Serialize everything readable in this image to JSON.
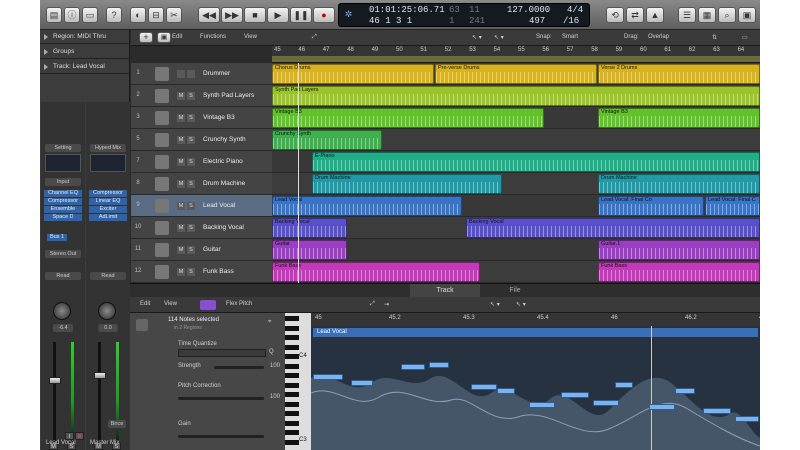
{
  "control_bar": {
    "lcd": {
      "time": "01:01:25:06.71",
      "bars": "46 1 3 1",
      "sub1": "63",
      "sub2": "1",
      "tempo": "127.0000",
      "tempo_sub": "497",
      "sig_top": "4/4",
      "sig_bottom": "/16",
      "sub3": "11",
      "sub4": "241"
    }
  },
  "inspector": {
    "rows": [
      "Region: MIDI Thru",
      "Groups",
      "Track: Lead Vocal"
    ],
    "strip_left": {
      "setting": "Setting",
      "input": "Input",
      "plugins": [
        "Channel EQ",
        "Compressor",
        "Ensemble",
        "Space D"
      ],
      "bus": "Bus 1",
      "output": "Stereo Out",
      "mode": "Read",
      "value": "-6.4",
      "name": "Lead Vocal",
      "m": "M",
      "s": "S",
      "i": "I",
      "r": "R"
    },
    "strip_right": {
      "setting": "Hyped Mix",
      "plugins": [
        "Compressor",
        "Linear EQ",
        "Exciter",
        "AdLimit"
      ],
      "mode": "Read",
      "value": "0.0",
      "bnce": "Bnce",
      "name": "Master Mix",
      "m": "M",
      "s": "S"
    }
  },
  "track_toolbar": {
    "edit": "Edit",
    "functions": "Functions",
    "view": "View",
    "snap_label": "Snap:",
    "snap_value": "Smart",
    "drag_label": "Drag:",
    "drag_value": "Overlap"
  },
  "ruler_marks": [
    "45",
    "46",
    "47",
    "48",
    "49",
    "50",
    "51",
    "52",
    "53",
    "54",
    "55",
    "56",
    "57",
    "58",
    "59",
    "60",
    "61",
    "62",
    "63",
    "64"
  ],
  "tracks": [
    {
      "num": "1",
      "name": "Drummer",
      "m": "",
      "s": ""
    },
    {
      "num": "2",
      "name": "Synth Pad Layers",
      "m": "M",
      "s": "S"
    },
    {
      "num": "3",
      "name": "Vintage B3",
      "m": "M",
      "s": "S"
    },
    {
      "num": "5",
      "name": "Crunchy Synth",
      "m": "M",
      "s": "S"
    },
    {
      "num": "7",
      "name": "Electric Piano",
      "m": "M",
      "s": "S"
    },
    {
      "num": "8",
      "name": "Drum Machine",
      "m": "M",
      "s": "S"
    },
    {
      "num": "9",
      "name": "Lead Vocal",
      "m": "M",
      "s": "S"
    },
    {
      "num": "10",
      "name": "Backing Vocal",
      "m": "M",
      "s": "S"
    },
    {
      "num": "11",
      "name": "Guitar",
      "m": "M",
      "s": "S"
    },
    {
      "num": "12",
      "name": "Funk Bass",
      "m": "M",
      "s": "S"
    }
  ],
  "regions": [
    {
      "lane": 0,
      "label": "Chorus Drums",
      "color": "#d8b21f",
      "start": 0,
      "end": 162
    },
    {
      "lane": 0,
      "label": "Pre-verse Drums",
      "color": "#d8b21f",
      "start": 163,
      "end": 325
    },
    {
      "lane": 0,
      "label": "Verse 2 Drums",
      "color": "#d8b21f",
      "start": 326,
      "end": 488
    },
    {
      "lane": 1,
      "label": "Synth Pad Layers",
      "color": "#9bc42a",
      "start": 0,
      "end": 488
    },
    {
      "lane": 2,
      "label": "Vintage B3",
      "color": "#62c22c",
      "start": 0,
      "end": 272
    },
    {
      "lane": 2,
      "label": "Vintage B3",
      "color": "#62c22c",
      "start": 326,
      "end": 488
    },
    {
      "lane": 3,
      "label": "Crunchy Synth",
      "color": "#3eb04e",
      "start": 0,
      "end": 110
    },
    {
      "lane": 4,
      "label": "E-Piano",
      "color": "#1fae86",
      "start": 40,
      "end": 488
    },
    {
      "lane": 5,
      "label": "Drum Machine",
      "color": "#1f9aa6",
      "start": 40,
      "end": 230
    },
    {
      "lane": 5,
      "label": "Drum Machine",
      "color": "#1f9aa6",
      "start": 326,
      "end": 488
    },
    {
      "lane": 6,
      "label": "Lead Vocal",
      "color": "#3a74c6",
      "start": 0,
      "end": 190
    },
    {
      "lane": 6,
      "label": "Lead Vocal: Final Co",
      "color": "#3a74c6",
      "start": 326,
      "end": 432
    },
    {
      "lane": 6,
      "label": "Lead Vocal: Final C",
      "color": "#3a74c6",
      "start": 433,
      "end": 488
    },
    {
      "lane": 7,
      "label": "Backing Vocal",
      "color": "#5850c8",
      "start": 0,
      "end": 75
    },
    {
      "lane": 7,
      "label": "Backing Vocal",
      "color": "#5850c8",
      "start": 194,
      "end": 488
    },
    {
      "lane": 8,
      "label": "Guitar",
      "color": "#9a3fc2",
      "start": 0,
      "end": 75
    },
    {
      "lane": 8,
      "label": "Guitar.1",
      "color": "#9a3fc2",
      "start": 326,
      "end": 488
    },
    {
      "lane": 9,
      "label": "Funk Bass",
      "color": "#c23ab8",
      "start": 0,
      "end": 208
    },
    {
      "lane": 9,
      "label": "Funk Bass",
      "color": "#c23ab8",
      "start": 326,
      "end": 488
    }
  ],
  "editor": {
    "tabs": [
      "Track",
      "File"
    ],
    "edit": "Edit",
    "view": "View",
    "mode": "Flex Pitch",
    "notes_selected": "114 Notes selected",
    "notes_sub": "in 2 Regions",
    "time_quantize": "Time Quantize",
    "strength": "Strength",
    "strength_val": "100",
    "pitch_correction": "Pitch Correction",
    "pitch_val": "100",
    "gain": "Gain",
    "key_c4": "C4",
    "key_c3": "C3",
    "ruler": [
      "45",
      "45.2",
      "45.3",
      "45.4",
      "46",
      "46.2",
      "46.3"
    ],
    "region_label": "Lead Vocal"
  }
}
